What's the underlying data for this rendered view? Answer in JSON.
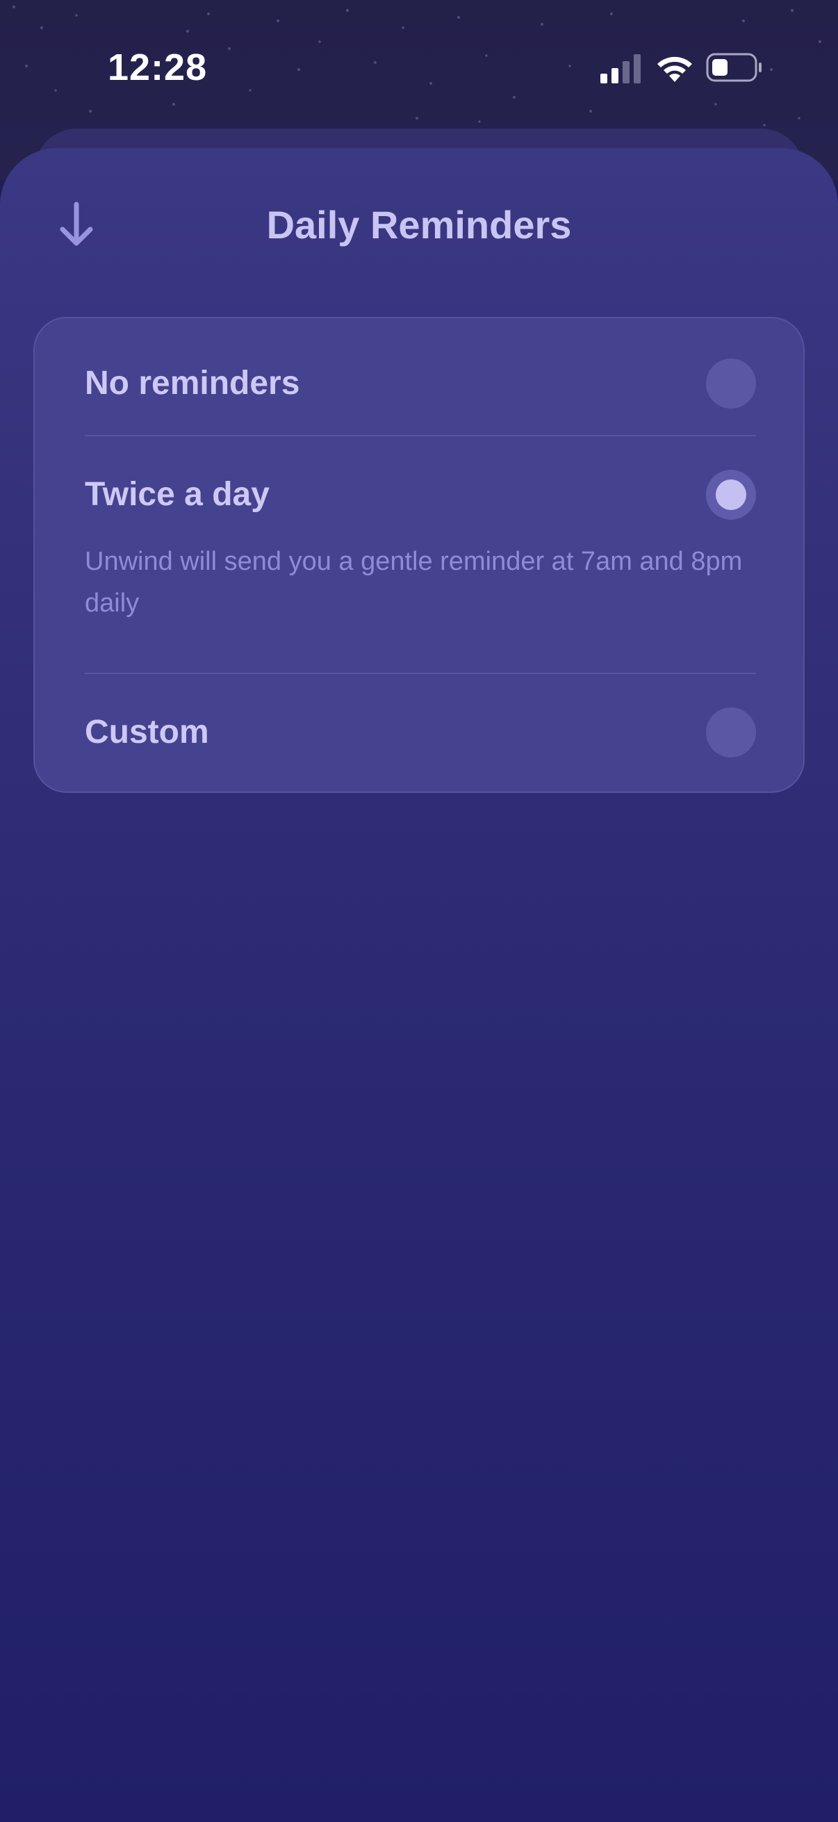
{
  "status_bar": {
    "time": "12:28",
    "icons": [
      "signal-icon",
      "wifi-icon",
      "battery-icon"
    ]
  },
  "header": {
    "title": "Daily Reminders",
    "close_icon": "arrow-down-icon"
  },
  "options": [
    {
      "label": "No reminders",
      "selected": false
    },
    {
      "label": "Twice a day",
      "selected": true,
      "description": "Unwind will send you a gentle reminder at 7am and 8pm daily"
    },
    {
      "label": "Custom",
      "selected": false
    }
  ],
  "colors": {
    "background": "#1f1d52",
    "sheet_top": "#3b3884",
    "card": "#45428f",
    "text_primary": "#cdc9f5",
    "text_secondary": "#8e8bd9",
    "radio_selected_dot": "#c4c0f2"
  }
}
